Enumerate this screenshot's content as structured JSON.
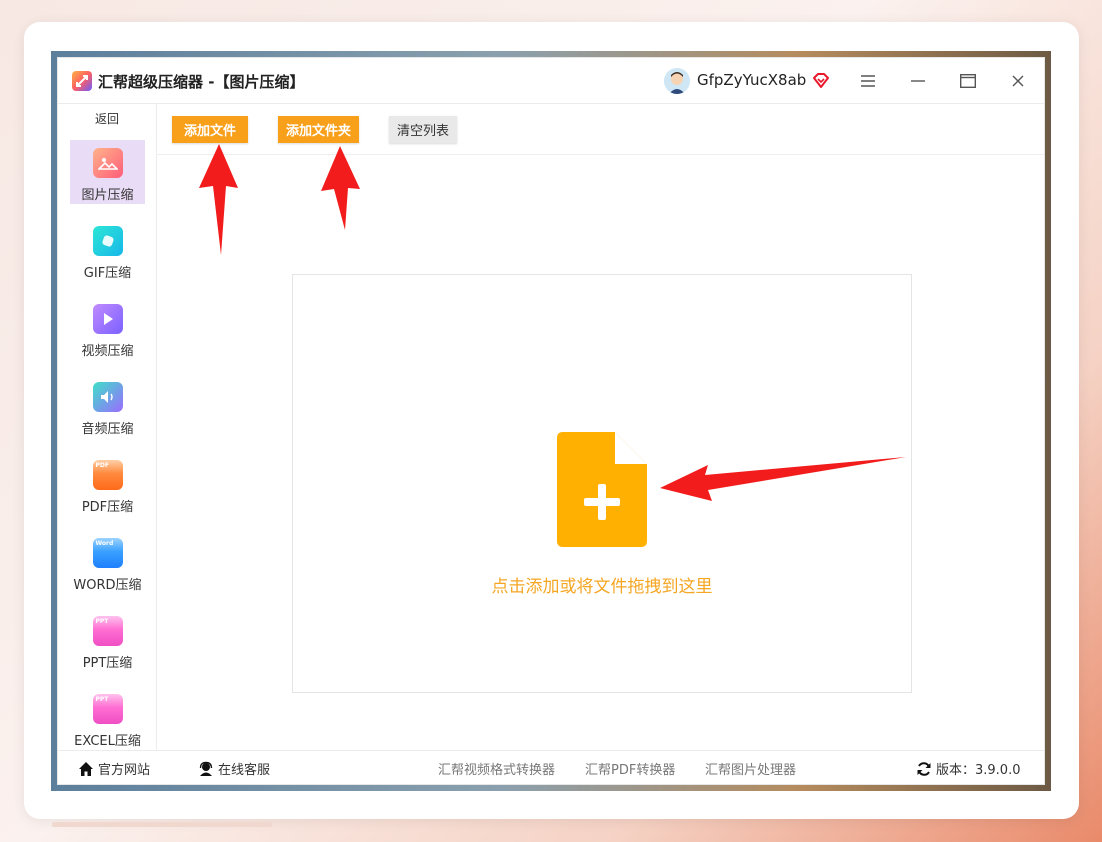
{
  "window": {
    "app_name": "汇帮超级压缩器",
    "title_suffix": " -【图片压缩】",
    "username": "GfpZyYucX8ab"
  },
  "sidebar": {
    "back_label": "返回",
    "items": [
      {
        "label": "图片压缩",
        "icon": "image-icon",
        "active": true
      },
      {
        "label": "GIF压缩",
        "icon": "gif-icon"
      },
      {
        "label": "视频压缩",
        "icon": "video-icon"
      },
      {
        "label": "音频压缩",
        "icon": "audio-icon"
      },
      {
        "label": "PDF压缩",
        "icon": "pdf-icon",
        "badge": "PDF"
      },
      {
        "label": "WORD压缩",
        "icon": "word-icon",
        "badge": "Word"
      },
      {
        "label": "PPT压缩",
        "icon": "ppt-icon",
        "badge": "PPT"
      },
      {
        "label": "EXCEL压缩",
        "icon": "excel-icon",
        "badge": "PPT"
      }
    ]
  },
  "toolbar": {
    "add_file_label": "添加文件",
    "add_folder_label": "添加文件夹",
    "clear_list_label": "清空列表"
  },
  "dropzone": {
    "hint": "点击添加或将文件拖拽到这里"
  },
  "footer": {
    "official_site": "官方网站",
    "online_service": "在线客服",
    "links": [
      "汇帮视频格式转换器",
      "汇帮PDF转换器",
      "汇帮图片处理器"
    ],
    "version": "版本：3.9.0.0"
  },
  "colors": {
    "accent_orange": "#f9a01b",
    "file_icon": "#ffb000",
    "active_sidebar_bg": "#e9dcf7",
    "annotation_arrow": "#f21c1c"
  }
}
